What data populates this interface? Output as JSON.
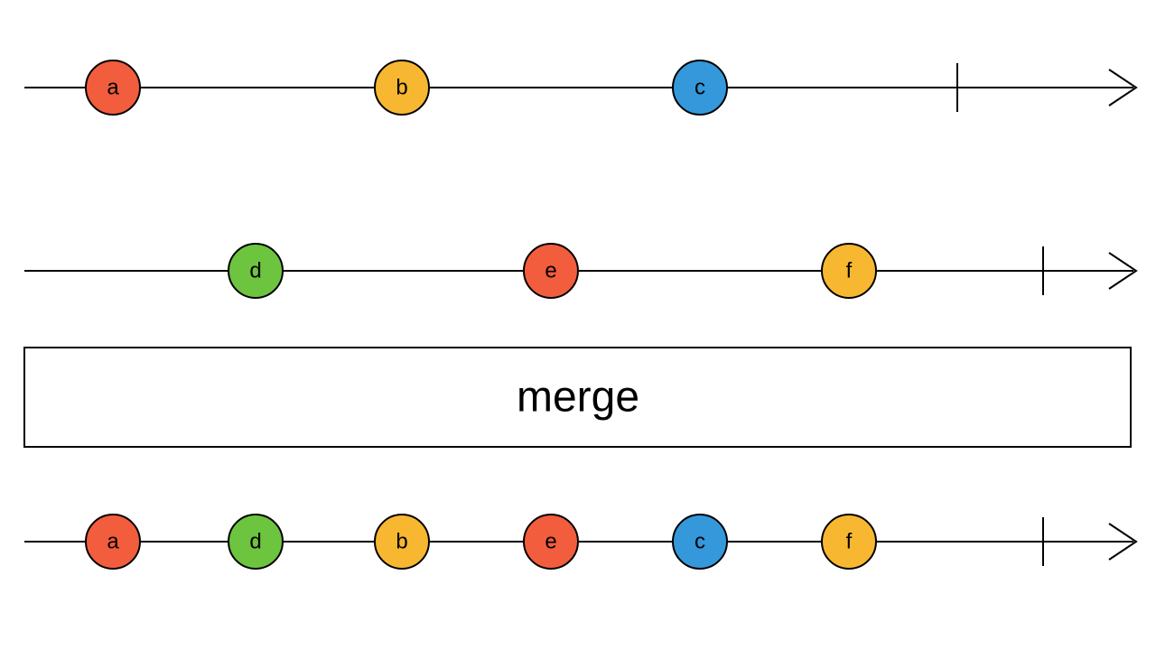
{
  "colors": {
    "red": "#f25d3d",
    "yellow": "#f7b731",
    "blue": "#3498db",
    "green": "#6dc43f",
    "stroke": "#000000"
  },
  "operator": {
    "label": "merge"
  },
  "timelines": {
    "first": {
      "nodes": [
        {
          "label": "a",
          "colorKey": "red"
        },
        {
          "label": "b",
          "colorKey": "yellow"
        },
        {
          "label": "c",
          "colorKey": "blue"
        }
      ]
    },
    "second": {
      "nodes": [
        {
          "label": "d",
          "colorKey": "green"
        },
        {
          "label": "e",
          "colorKey": "red"
        },
        {
          "label": "f",
          "colorKey": "yellow"
        }
      ]
    },
    "result": {
      "nodes": [
        {
          "label": "a",
          "colorKey": "red"
        },
        {
          "label": "d",
          "colorKey": "green"
        },
        {
          "label": "b",
          "colorKey": "yellow"
        },
        {
          "label": "e",
          "colorKey": "red"
        },
        {
          "label": "c",
          "colorKey": "blue"
        },
        {
          "label": "f",
          "colorKey": "yellow"
        }
      ]
    }
  }
}
